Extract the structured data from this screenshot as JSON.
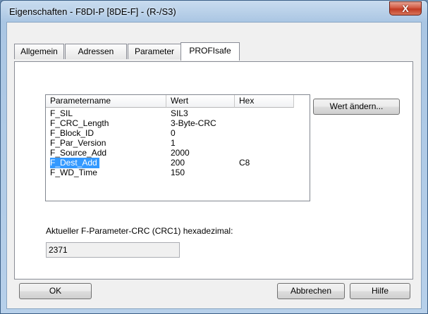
{
  "window": {
    "title": "Eigenschaften - F8DI-P [8DE-F] - (R-/S3)",
    "close_glyph": "X"
  },
  "tabs": [
    {
      "label": "Allgemein",
      "active": false
    },
    {
      "label": "Adressen",
      "active": false
    },
    {
      "label": "Parameter",
      "active": false
    },
    {
      "label": "PROFIsafe",
      "active": true
    }
  ],
  "parameters": {
    "columns": [
      "Parametername",
      "Wert",
      "Hex"
    ],
    "rows": [
      {
        "name": "F_SIL",
        "value": "SIL3",
        "hex": ""
      },
      {
        "name": "F_CRC_Length",
        "value": "3-Byte-CRC",
        "hex": ""
      },
      {
        "name": "F_Block_ID",
        "value": "0",
        "hex": ""
      },
      {
        "name": "F_Par_Version",
        "value": "1",
        "hex": ""
      },
      {
        "name": "F_Source_Add",
        "value": "2000",
        "hex": ""
      },
      {
        "name": "F_Dest_Add",
        "value": "200",
        "hex": "C8"
      },
      {
        "name": "F_WD_Time",
        "value": "150",
        "hex": ""
      }
    ],
    "selected_index": 5
  },
  "change_value_button": "Wert ändern...",
  "crc": {
    "label": "Aktueller F-Parameter-CRC (CRC1) hexadezimal:",
    "value": "2371"
  },
  "footer": {
    "ok": "OK",
    "cancel": "Abbrechen",
    "help": "Hilfe"
  },
  "colors": {
    "selection": "#3399ff",
    "close_button": "#c13b23"
  }
}
